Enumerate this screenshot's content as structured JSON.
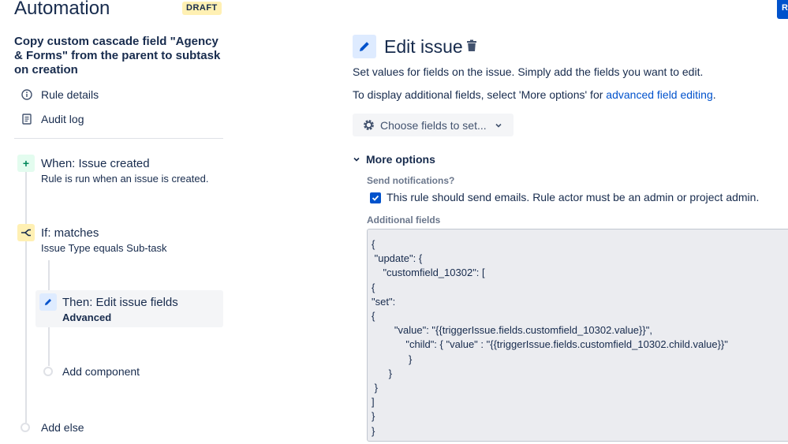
{
  "header": {
    "app_title": "Automation",
    "draft_badge": "DRAFT",
    "corner_button_label": "R"
  },
  "sidebar": {
    "rule_name": "Copy custom cascade field \"Agency & Forms\" from the parent to subtask on creation",
    "nav": [
      {
        "label": "Rule details",
        "icon": "info-icon"
      },
      {
        "label": "Audit log",
        "icon": "document-icon"
      }
    ],
    "steps": {
      "trigger": {
        "title": "When: Issue created",
        "subtitle": "Rule is run when an issue is created.",
        "icon": "plus-icon",
        "color": "#e3fcef"
      },
      "condition": {
        "title": "If: matches",
        "subtitle": "Issue Type equals Sub-task",
        "icon": "branch-icon",
        "color": "#fff0b3"
      },
      "action": {
        "title": "Then: Edit issue fields",
        "subtitle": "Advanced",
        "icon": "pencil-icon",
        "color": "#deebff"
      },
      "add_component": "Add component",
      "add_else": "Add else"
    }
  },
  "main": {
    "title": "Edit issue",
    "description_1": "Set values for fields on the issue. Simply add the fields you want to edit.",
    "description_2_prefix": "To display additional fields, select 'More options' for ",
    "description_2_link": "advanced field editing",
    "description_2_suffix": ".",
    "choose_fields_label": "Choose fields to set...",
    "more_options_label": "More options",
    "send_notifications_label": "Send notifications?",
    "send_emails_checkbox": {
      "label": "This rule should send emails. Rule actor must be an admin or project admin.",
      "checked": true
    },
    "additional_fields_label": "Additional fields",
    "additional_fields_value": "{\n \"update\": {\n    \"customfield_10302\": [\n{\n\"set\":\n{\n        \"value\": \"{{triggerIssue.fields.customfield_10302.value}}\",\n            \"child\": { \"value\" : \"{{triggerIssue.fields.customfield_10302.child.value}}\"\n             }\n      }\n }\n]\n}\n}"
  },
  "colors": {
    "accent": "#0052cc",
    "link": "#0052cc",
    "text": "#172b4d"
  }
}
